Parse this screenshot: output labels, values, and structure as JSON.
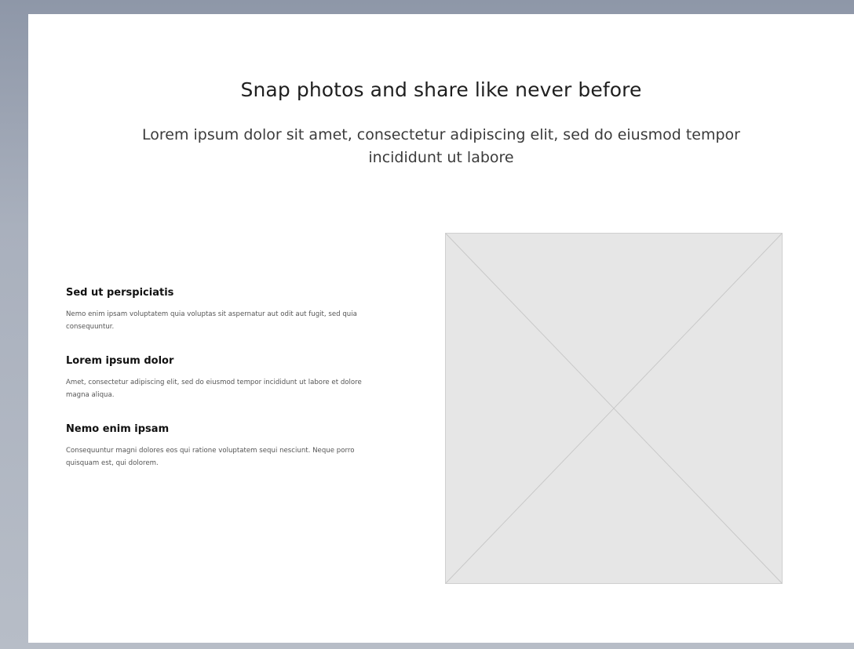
{
  "hero": {
    "title": "Snap photos and share like never before",
    "subtitle": "Lorem ipsum dolor sit amet, consectetur adipiscing elit, sed do eiusmod tempor incididunt ut labore"
  },
  "features": [
    {
      "title": "Sed ut perspiciatis",
      "description": "Nemo enim ipsam voluptatem quia voluptas sit aspernatur aut odit aut fugit, sed quia consequuntur."
    },
    {
      "title": "Lorem ipsum dolor",
      "description": "Amet, consectetur adipiscing elit, sed do eiusmod tempor incididunt ut labore et dolore magna aliqua."
    },
    {
      "title": "Nemo enim ipsam",
      "description": "Consequuntur magni dolores eos qui ratione voluptatem sequi nesciunt. Neque porro quisquam est, qui dolorem."
    }
  ],
  "image": {
    "icon": "image-placeholder-icon"
  },
  "colors": {
    "background": "#a9b0bd",
    "canvas": "#ffffff",
    "placeholder": "#e6e6e6"
  }
}
